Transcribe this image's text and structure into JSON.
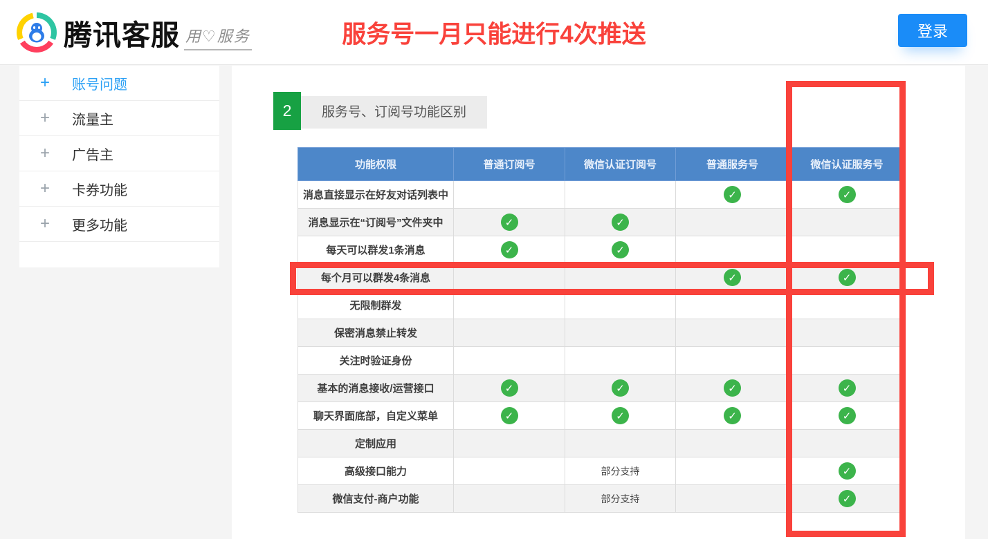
{
  "header": {
    "logo_text": "腾讯客服",
    "logo_slogan": "用♡服务",
    "banner_title": "服务号一月只能进行4次推送",
    "login_label": "登录"
  },
  "sidebar": {
    "expand_icon": "+",
    "items": [
      {
        "label": "账号问题",
        "active": true
      },
      {
        "label": "流量主",
        "active": false
      },
      {
        "label": "广告主",
        "active": false
      },
      {
        "label": "卡券功能",
        "active": false
      },
      {
        "label": "更多功能",
        "active": false
      }
    ]
  },
  "section": {
    "badge": "2",
    "title": "服务号、订阅号功能区别"
  },
  "table": {
    "columns": [
      "功能权限",
      "普通订阅号",
      "微信认证订阅号",
      "普通服务号",
      "微信认证服务号"
    ],
    "check_symbol": "✓",
    "rows": [
      {
        "feature": "消息直接显示在好友对话列表中",
        "cells": [
          "",
          "",
          "check",
          "check"
        ]
      },
      {
        "feature": "消息显示在“订阅号”文件夹中",
        "cells": [
          "check",
          "check",
          "",
          ""
        ]
      },
      {
        "feature": "每天可以群发1条消息",
        "cells": [
          "check",
          "check",
          "",
          ""
        ]
      },
      {
        "feature": "每个月可以群发4条消息",
        "cells": [
          "",
          "",
          "check",
          "check"
        ]
      },
      {
        "feature": "无限制群发",
        "cells": [
          "",
          "",
          "",
          ""
        ]
      },
      {
        "feature": "保密消息禁止转发",
        "cells": [
          "",
          "",
          "",
          ""
        ]
      },
      {
        "feature": "关注时验证身份",
        "cells": [
          "",
          "",
          "",
          ""
        ]
      },
      {
        "feature": "基本的消息接收/运营接口",
        "cells": [
          "check",
          "check",
          "check",
          "check"
        ]
      },
      {
        "feature": "聊天界面底部，自定义菜单",
        "cells": [
          "check",
          "check",
          "check",
          "check"
        ]
      },
      {
        "feature": "定制应用",
        "cells": [
          "",
          "",
          "",
          ""
        ]
      },
      {
        "feature": "高级接口能力",
        "cells": [
          "",
          "部分支持",
          "",
          "check"
        ]
      },
      {
        "feature": "微信支付-商户功能",
        "cells": [
          "",
          "部分支持",
          "",
          "check"
        ]
      }
    ]
  },
  "annotations": {
    "highlight_color": "#f9423b",
    "highlighted_row": "每个月可以群发4条消息",
    "highlighted_column": "微信认证服务号"
  },
  "colors": {
    "login_blue": "#1a8cf8",
    "table_header_blue": "#4d87c9",
    "check_green": "#3cb44b",
    "badge_green": "#17a143",
    "active_item_blue": "#2aa0f5",
    "annotation_red": "#f9423b",
    "zebra_gray": "#f2f2f2"
  }
}
